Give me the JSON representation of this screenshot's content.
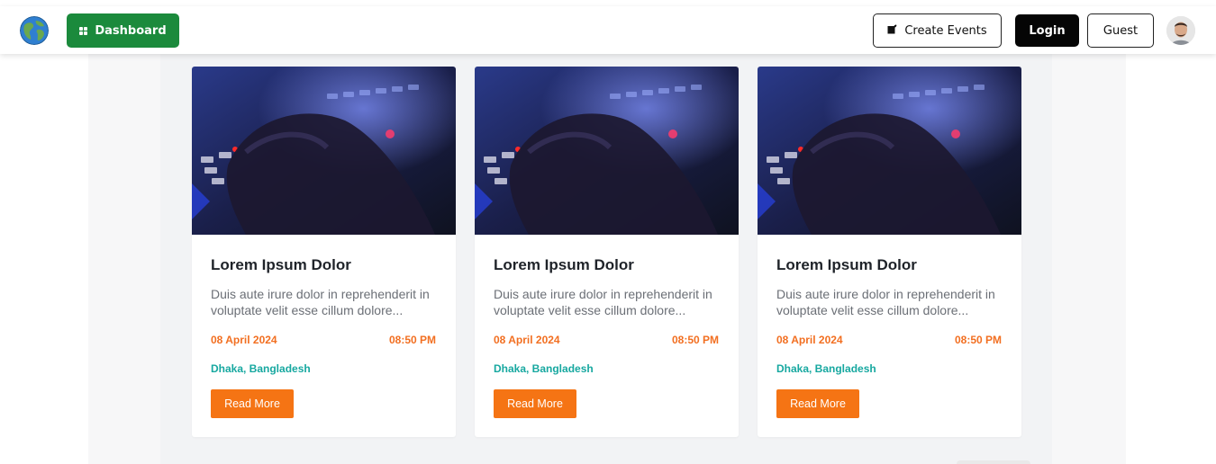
{
  "nav": {
    "logo_icon": "globe-icon",
    "dashboard_label": "Dashboard",
    "dashboard_icon": "grid-icon",
    "create_events_label": "Create Events",
    "create_events_icon": "edit-icon",
    "login_label": "Login",
    "guest_label": "Guest",
    "avatar_icon": "user-avatar",
    "colors": {
      "dashboard_bg": "#1b8a3c",
      "login_bg": "#050505"
    }
  },
  "events": [
    {
      "title": "Lorem Ipsum Dolor",
      "description": "Duis aute irure dolor in reprehenderit in voluptate velit esse cillum dolore...",
      "date": "08 April 2024",
      "time": "08:50 PM",
      "location": "Dhaka, Bangladesh",
      "button": "Read More"
    },
    {
      "title": "Lorem Ipsum Dolor",
      "description": "Duis aute irure dolor in reprehenderit in voluptate velit esse cillum dolore...",
      "date": "08 April 2024",
      "time": "08:50 PM",
      "location": "Dhaka, Bangladesh",
      "button": "Read More"
    },
    {
      "title": "Lorem Ipsum Dolor",
      "description": "Duis aute irure dolor in reprehenderit in voluptate velit esse cillum dolore...",
      "date": "08 April 2024",
      "time": "08:50 PM",
      "location": "Dhaka, Bangladesh",
      "button": "Read More"
    }
  ],
  "colors": {
    "accent_orange": "#f57414",
    "date_orange": "#f26f21",
    "location_teal": "#17a8a0"
  }
}
